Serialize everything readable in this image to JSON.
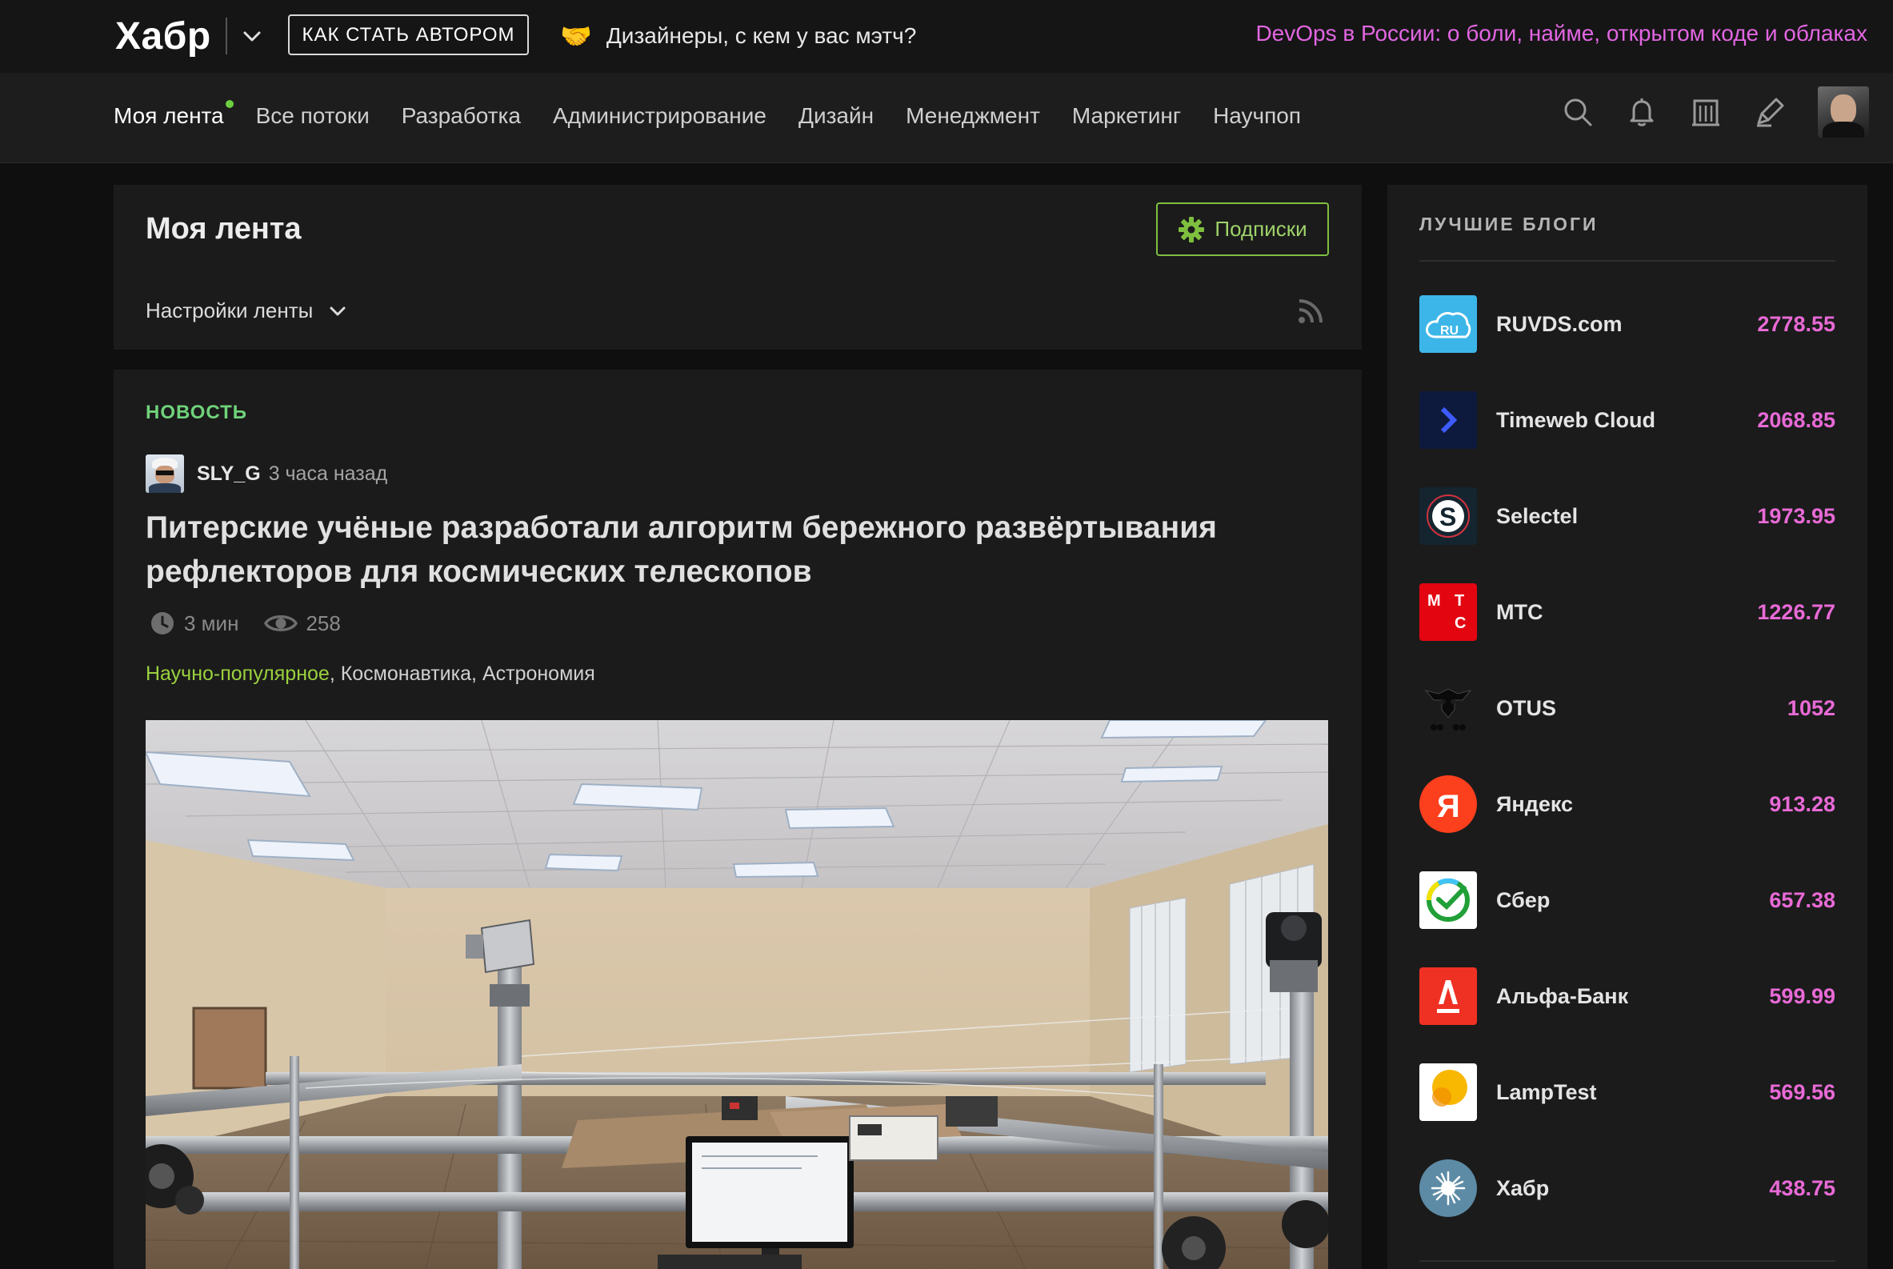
{
  "topbar": {
    "logo": "Хабр",
    "author_button": "Как стать автором",
    "promo_text": "Дизайнеры, с кем у вас мэтч?",
    "promo_right": "DevOps в России: о боли, найме, открытом коде и облаках"
  },
  "nav": {
    "items": [
      {
        "label": "Моя лента",
        "active": true
      },
      {
        "label": "Все потоки"
      },
      {
        "label": "Разработка"
      },
      {
        "label": "Администрирование"
      },
      {
        "label": "Дизайн"
      },
      {
        "label": "Менеджмент"
      },
      {
        "label": "Маркетинг"
      },
      {
        "label": "Научпоп"
      }
    ],
    "icons": [
      "search-icon",
      "bell-icon",
      "companies-icon",
      "write-icon"
    ]
  },
  "feed": {
    "title": "Моя лента",
    "subscriptions_label": "Подписки",
    "settings_label": "Настройки ленты"
  },
  "article": {
    "type_label": "НОВОСТЬ",
    "author": "SLY_G",
    "time": "3 часа назад",
    "title": "Питерские учёные разработали алгоритм бережного развёртывания рефлекторов для космических телескопов",
    "reading_time": "3 мин",
    "views": "258",
    "hubs": [
      "Научно-популярное",
      "Космонавтика",
      "Астрономия"
    ]
  },
  "sidebar": {
    "title": "ЛУЧШИЕ БЛОГИ",
    "blogs": [
      {
        "name": "RUVDS.com",
        "rating": "2778.55",
        "logo": "ruvds-logo",
        "color": "#3cb6e8"
      },
      {
        "name": "Timeweb Cloud",
        "rating": "2068.85",
        "logo": "timeweb-logo",
        "color": "#0d1a3d"
      },
      {
        "name": "Selectel",
        "rating": "1973.95",
        "logo": "selectel-logo",
        "color": "#14252f"
      },
      {
        "name": "МТС",
        "rating": "1226.77",
        "logo": "mts-logo",
        "color": "#e30611"
      },
      {
        "name": "OTUS",
        "rating": "1052",
        "logo": "otus-logo",
        "color": "#1b1b1b"
      },
      {
        "name": "Яндекс",
        "rating": "913.28",
        "logo": "yandex-logo",
        "color": "#fc3f1d"
      },
      {
        "name": "Сбер",
        "rating": "657.38",
        "logo": "sber-logo",
        "color": "#ffffff"
      },
      {
        "name": "Альфа-Банк",
        "rating": "599.99",
        "logo": "alfa-logo",
        "color": "#ef3124"
      },
      {
        "name": "LampTest",
        "rating": "569.56",
        "logo": "lamptest-logo",
        "color": "#ffffff"
      },
      {
        "name": "Хабр",
        "rating": "438.75",
        "logo": "habr-logo",
        "color": "#5d8ba5"
      }
    ]
  },
  "colors": {
    "accent_pink": "#e86ad6",
    "accent_green": "#9ad13e",
    "news_green": "#6fd37a"
  }
}
